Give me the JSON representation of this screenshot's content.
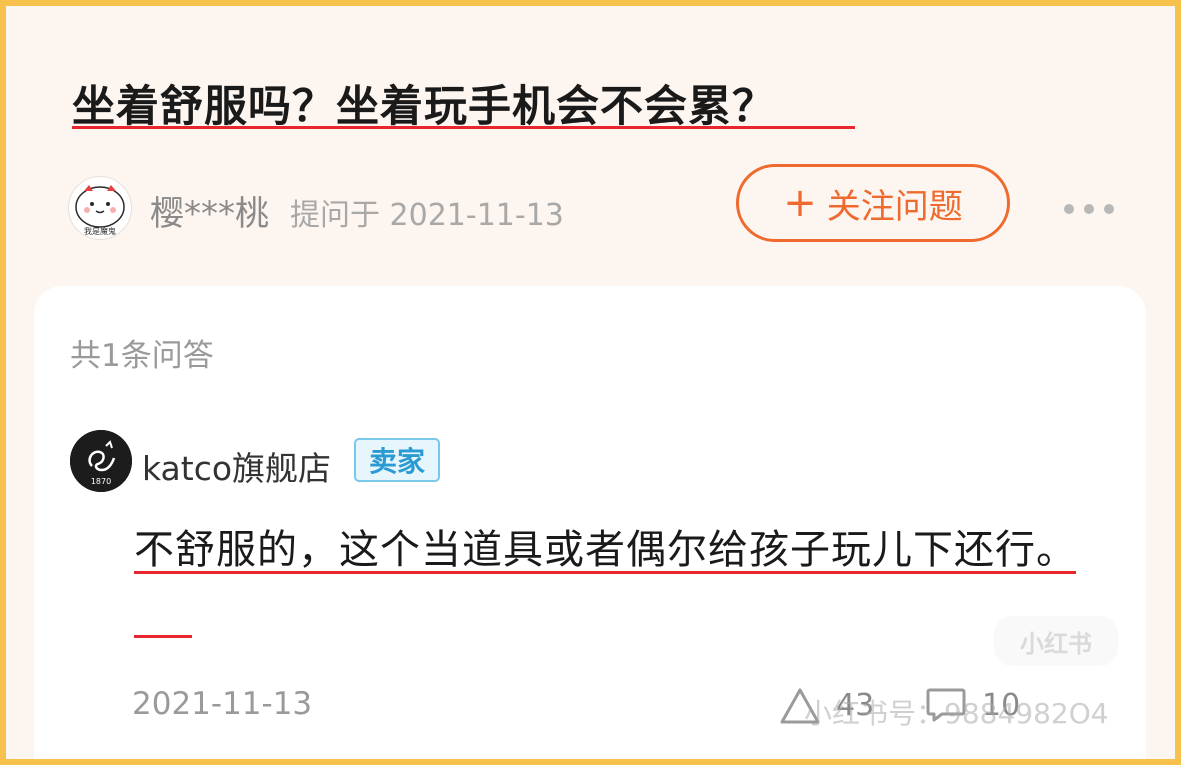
{
  "question": {
    "title": "坐着舒服吗？坐着玩手机会不会累？",
    "asker": {
      "name": "樱***桃",
      "meta": "提问于 2021-11-13",
      "avatar_caption": "我是魔鬼"
    },
    "follow_label": "关注问题",
    "follow_icon": "plus-icon",
    "more_icon": "more-dots-icon"
  },
  "answers": {
    "count_label": "共1条问答",
    "items": [
      {
        "seller_name": "katco旗舰店",
        "seller_badge": "卖家",
        "avatar_caption": "1870",
        "text": "不舒服的，这个当道具或者偶尔给孩子玩儿下还行。",
        "date": "2021-11-13",
        "like_count": "43",
        "comment_count": "10"
      }
    ]
  },
  "watermark": {
    "logo_text": "小红书",
    "id_text": "小红书号：9884982O4"
  },
  "colors": {
    "accent": "#ef6a2e",
    "underline": "#e8262e",
    "badge_text": "#2a9bd2",
    "frame_border": "#f6c24c"
  }
}
